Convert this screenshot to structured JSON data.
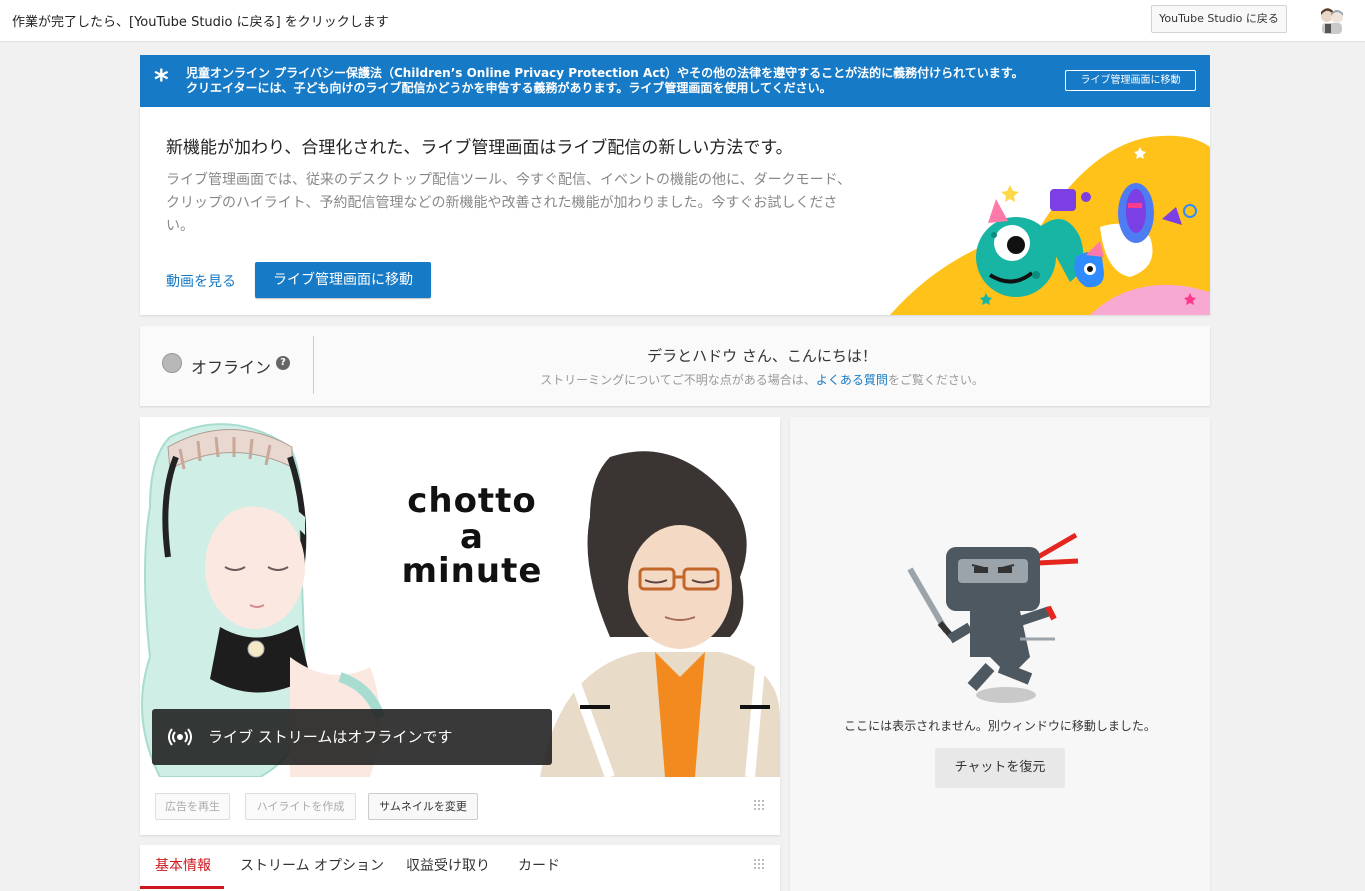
{
  "topbar": {
    "instruction": "作業が完了したら、[YouTube Studio に戻る] をクリックします",
    "return_button": "YouTube Studio に戻る"
  },
  "banner": {
    "line1": "児童オンライン プライバシー保護法（Children’s Online Privacy Protection Act）やその他の法律を遵守することが法的に義務付けられています。",
    "line2": "クリエイターには、子ども向けのライブ配信かどうかを申告する義務があります。ライブ管理画面を使用してください。",
    "button": "ライブ管理画面に移動",
    "color": "#167ac6"
  },
  "promo": {
    "title": "新機能が加わり、合理化された、ライブ管理画面はライブ配信の新しい方法です。",
    "desc_line1": "ライブ管理画面では、従来のデスクトップ配信ツール、今すぐ配信、イベントの機能の他に、ダークモード、",
    "desc_line2": "クリップのハイライト、予約配信管理などの新機能や改善された機能が加わりました。今すぐお試しくださ",
    "desc_line3": "い。",
    "watch_link": "動画を見る",
    "go_button": "ライブ管理画面に移動"
  },
  "status": {
    "state": "オフライン",
    "greeting": "デラとハドウ さん、こんにちは！",
    "faq_before": "ストリーミングについてご不明な点がある場合は、",
    "faq_link": "よくある質問",
    "faq_after": "をご覧ください。"
  },
  "preview": {
    "thumb_line1": "chotto",
    "thumb_line2": "a",
    "thumb_line3": "minute",
    "offline_msg": "ライブ ストリームはオフラインです"
  },
  "player_buttons": {
    "play_ad": "広告を再生",
    "create_highlight": "ハイライトを作成",
    "change_thumbnail": "サムネイルを変更"
  },
  "tabs": [
    "基本情報",
    "ストリーム オプション",
    "収益受け取り",
    "カード"
  ],
  "chat": {
    "message": "ここには表示されません。別ウィンドウに移動しました。",
    "restore_button": "チャットを復元"
  },
  "accent_color": "#cc181e"
}
